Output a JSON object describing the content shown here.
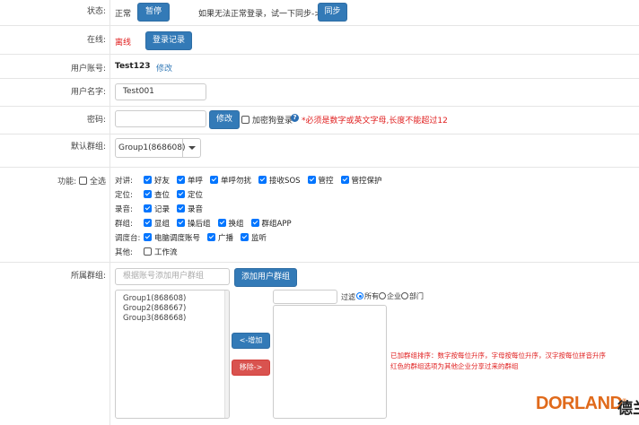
{
  "status": {
    "label": "状态:",
    "value": "正常",
    "pause_button": "暂停",
    "sync_hint": "如果无法正常登录，试一下同步->",
    "sync_button": "同步"
  },
  "online": {
    "label": "在线:",
    "value": "离线",
    "login_record_button": "登录记录"
  },
  "account": {
    "label": "用户账号:",
    "value": "Test123",
    "edit_link": "修改"
  },
  "username": {
    "label": "用户名字:",
    "value": "Test001"
  },
  "password": {
    "label": "密码:",
    "value": "",
    "edit_button": "修改",
    "encrypt_label": "加密狗登录",
    "help_icon": "?",
    "hint": "*必须是数字或英文字母,长度不能超过12"
  },
  "default_group": {
    "label": "默认群组:",
    "selected": "Group1(868608)"
  },
  "functions": {
    "label": "功能:",
    "select_all": "全选",
    "rows": [
      {
        "category": "对讲:",
        "items": [
          {
            "label": "好友",
            "checked": true
          },
          {
            "label": "单呼",
            "checked": true
          },
          {
            "label": "单呼勿扰",
            "checked": true
          },
          {
            "label": "接收SOS",
            "checked": true
          },
          {
            "label": "管控",
            "checked": true
          },
          {
            "label": "管控保护",
            "checked": true
          }
        ]
      },
      {
        "category": "定位:",
        "items": [
          {
            "label": "查位",
            "checked": true
          },
          {
            "label": "定位",
            "checked": true
          }
        ]
      },
      {
        "category": "录音:",
        "items": [
          {
            "label": "记录",
            "checked": true
          },
          {
            "label": "录音",
            "checked": true
          }
        ]
      },
      {
        "category": "群组:",
        "items": [
          {
            "label": "显组",
            "checked": true
          },
          {
            "label": "操后组",
            "checked": true
          },
          {
            "label": "换组",
            "checked": true
          },
          {
            "label": "群组APP",
            "checked": true
          }
        ]
      },
      {
        "category": "调度台:",
        "items": [
          {
            "label": "电脑调度账号",
            "checked": true
          },
          {
            "label": "广播",
            "checked": true
          },
          {
            "label": "监听",
            "checked": true
          }
        ]
      },
      {
        "category": "其他:",
        "items": [
          {
            "label": "工作流",
            "checked": false
          }
        ]
      }
    ]
  },
  "member_groups": {
    "label": "所属群组:",
    "search_placeholder": "根据账号添加用户群组",
    "add_button": "添加用户群组",
    "groups": [
      "Group1(868608)",
      "Group2(868667)",
      "Group3(868668)"
    ],
    "add_arrow_button": "<-增加",
    "remove_button": "移除->",
    "filter_value": "",
    "filter_label": "过滤",
    "filter_options": [
      {
        "label": "所有",
        "checked": true
      },
      {
        "label": "企业",
        "checked": false
      },
      {
        "label": "部门",
        "checked": false
      }
    ],
    "note_line1": "已加群组排序：数字按每位升序，字母按每位升序，汉字按每位拼音升序",
    "note_line2": "红色的群组选项为其他企业分享过来的群组"
  },
  "watermark": {
    "brand": "DORLAND",
    "suffix": "德兰"
  },
  "colors": {
    "primary": "#337ab7",
    "danger": "#d9534f",
    "error_text": "#e02020",
    "checkbox": "#0075ff",
    "watermark": "#e06a1b"
  }
}
